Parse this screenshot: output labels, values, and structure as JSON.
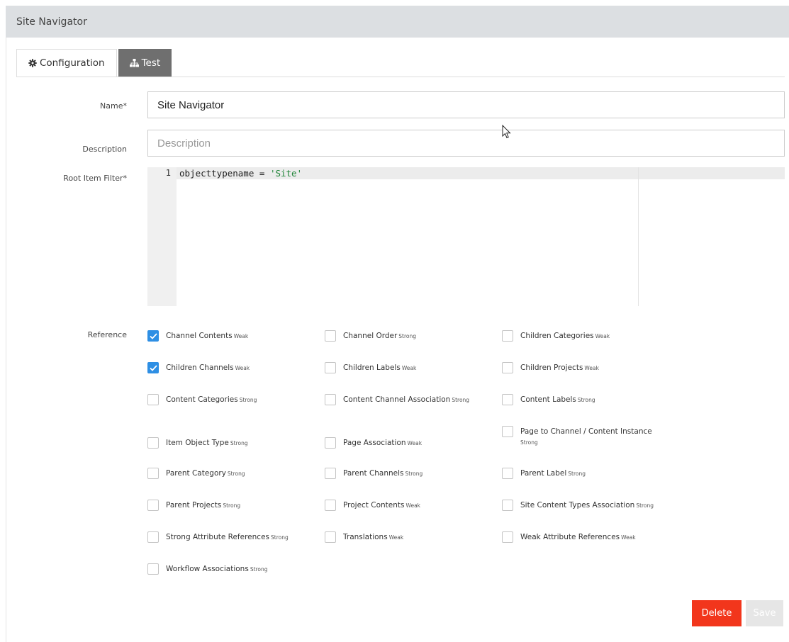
{
  "header": {
    "title": "Site Navigator"
  },
  "tabs": [
    {
      "label": "Configuration",
      "icon": "gear-icon",
      "active": true
    },
    {
      "label": "Test",
      "icon": "sitemap-icon",
      "active": false
    }
  ],
  "form": {
    "name": {
      "label": "Name*",
      "value": "Site Navigator"
    },
    "description": {
      "label": "Description",
      "value": "",
      "placeholder": "Description"
    },
    "root_filter": {
      "label": "Root Item Filter*",
      "line_number": "1",
      "code_key": "objecttypename",
      "code_op": " = ",
      "code_str": "'Site'"
    },
    "reference": {
      "label": "Reference"
    }
  },
  "references": [
    {
      "name": "Channel Contents",
      "strength": "Weak",
      "checked": true
    },
    {
      "name": "Channel Order",
      "strength": "Strong",
      "checked": false
    },
    {
      "name": "Children Categories",
      "strength": "Weak",
      "checked": false
    },
    {
      "name": "Children Channels",
      "strength": "Weak",
      "checked": true
    },
    {
      "name": "Children Labels",
      "strength": "Weak",
      "checked": false
    },
    {
      "name": "Children Projects",
      "strength": "Weak",
      "checked": false
    },
    {
      "name": "Content Categories",
      "strength": "Strong",
      "checked": false
    },
    {
      "name": "Content Channel Association",
      "strength": "Strong",
      "checked": false
    },
    {
      "name": "Content Labels",
      "strength": "Strong",
      "checked": false
    },
    {
      "name": "Item Object Type",
      "strength": "Strong",
      "checked": false
    },
    {
      "name": "Page Association",
      "strength": "Weak",
      "checked": false
    },
    {
      "name": "Page to Channel / Content Instance",
      "strength": "Strong",
      "checked": false
    },
    {
      "name": "Parent Category",
      "strength": "Strong",
      "checked": false
    },
    {
      "name": "Parent Channels",
      "strength": "Strong",
      "checked": false
    },
    {
      "name": "Parent Label",
      "strength": "Strong",
      "checked": false
    },
    {
      "name": "Parent Projects",
      "strength": "Strong",
      "checked": false
    },
    {
      "name": "Project Contents",
      "strength": "Weak",
      "checked": false
    },
    {
      "name": "Site Content Types Association",
      "strength": "Strong",
      "checked": false
    },
    {
      "name": "Strong Attribute References",
      "strength": "Strong",
      "checked": false
    },
    {
      "name": "Translations",
      "strength": "Weak",
      "checked": false
    },
    {
      "name": "Weak Attribute References",
      "strength": "Weak",
      "checked": false
    },
    {
      "name": "Workflow Associations",
      "strength": "Strong",
      "checked": false
    }
  ],
  "actions": {
    "delete_label": "Delete",
    "save_label": "Save"
  },
  "colors": {
    "accent": "#2e8fe4",
    "danger": "#f2361c",
    "tab_inactive": "#6f6f6f"
  }
}
